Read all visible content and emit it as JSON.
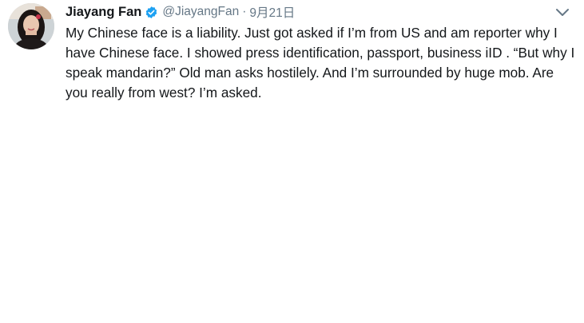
{
  "tweet": {
    "author_name": "Jiayang Fan",
    "handle": "@JiayangFan",
    "separator": "·",
    "date": "9月21日",
    "text": "My Chinese face is a liability. Just got asked if I’m from US and am reporter why I have Chinese face. I showed press identification, passport, business iID . “But why I speak mandarin?” Old man asks hostilely. And I’m surrounded by huge mob. Are you really from west? I’m asked.",
    "verified_icon": "verified-badge-icon",
    "menu_icon": "chevron-down-icon",
    "colors": {
      "text": "#14171a",
      "secondary": "#657786",
      "verified": "#1da1f2"
    }
  }
}
